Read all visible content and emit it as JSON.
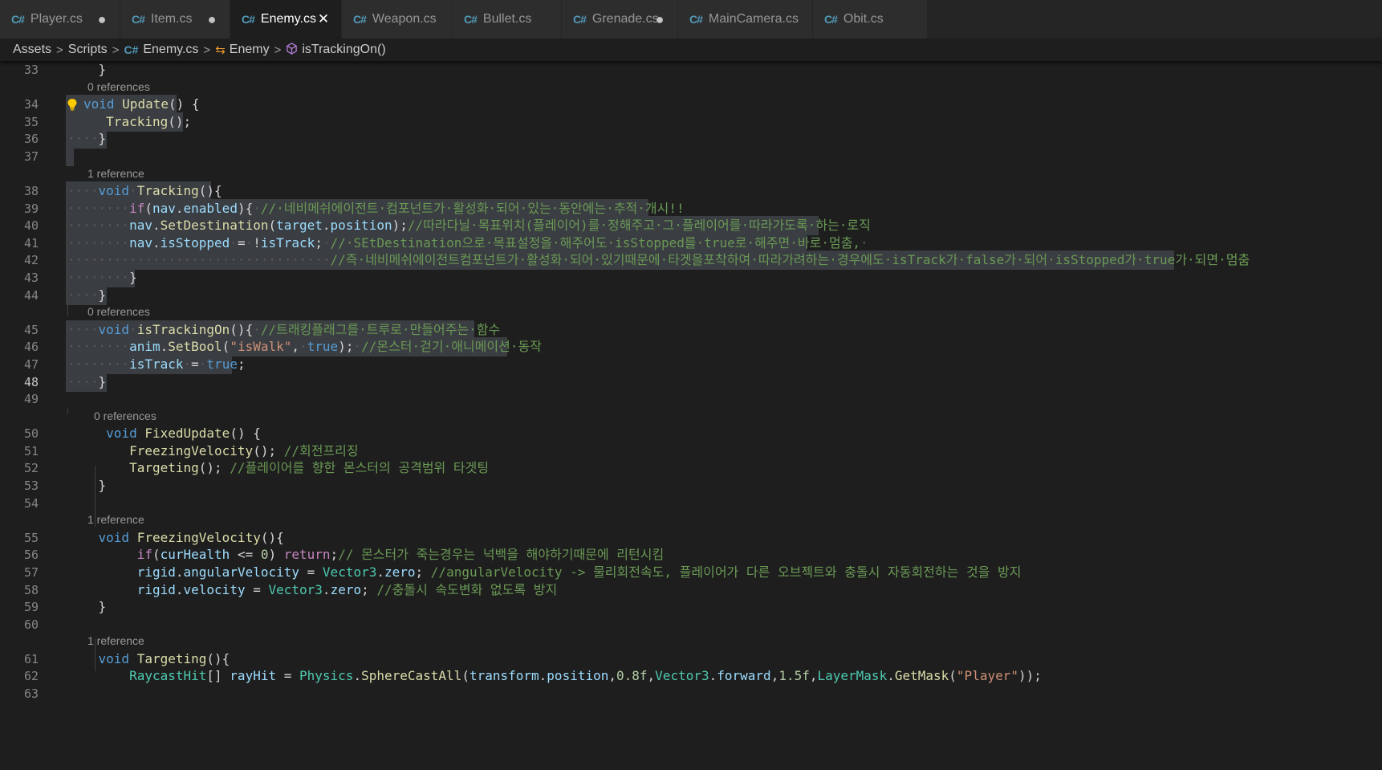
{
  "tabs": [
    {
      "label": "Player.cs",
      "status": "modified",
      "icon": "csharp-file-icon"
    },
    {
      "label": "Item.cs",
      "status": "modified",
      "icon": "csharp-file-icon"
    },
    {
      "label": "Enemy.cs",
      "status": "active-close",
      "icon": "csharp-file-icon"
    },
    {
      "label": "Weapon.cs",
      "status": "none",
      "icon": "csharp-file-icon"
    },
    {
      "label": "Bullet.cs",
      "status": "none",
      "icon": "csharp-file-icon"
    },
    {
      "label": "Grenade.cs",
      "status": "modified",
      "icon": "csharp-file-icon"
    },
    {
      "label": "MainCamera.cs",
      "status": "none",
      "icon": "csharp-file-icon"
    },
    {
      "label": "Obit.cs",
      "status": "none",
      "icon": "csharp-file-icon"
    }
  ],
  "tab_glyphs": {
    "csharp": "C#",
    "modified": "●",
    "close": "✕"
  },
  "breadcrumb": [
    {
      "label": "Assets",
      "icon": "none"
    },
    {
      "label": "Scripts",
      "icon": "none"
    },
    {
      "label": "Enemy.cs",
      "icon": "csharp-file-icon"
    },
    {
      "label": "Enemy",
      "icon": "class-icon"
    },
    {
      "label": "isTrackingOn()",
      "icon": "method-icon"
    }
  ],
  "breadcrumb_separator": ">",
  "colors": {
    "background": "#1e1e1e",
    "selection": "#3a3d41",
    "keyword": "#569cd6",
    "control": "#c586c0",
    "function": "#dcdcaa",
    "variable": "#9cdcfe",
    "type": "#4ec9b0",
    "number": "#b5cea8",
    "string": "#ce9178",
    "comment": "#6a9955",
    "lightbulb": "#ffcc00"
  },
  "editor": {
    "current_line": 48,
    "lightbulb_line": 34,
    "rows": [
      {
        "type": "code",
        "num": 33,
        "tokens": [
          [
            "p",
            "    }"
          ]
        ]
      },
      {
        "type": "lens",
        "text": "0 references"
      },
      {
        "type": "code",
        "num": 34,
        "sel": true,
        "tokens": [
          [
            "k",
            "void"
          ],
          [
            "w",
            " "
          ],
          [
            "f",
            "Update"
          ],
          [
            "p",
            "()"
          ],
          [
            "w",
            " "
          ],
          [
            "p",
            "{"
          ]
        ]
      },
      {
        "type": "code",
        "num": 35,
        "sel": true,
        "tokens": [
          [
            "w",
            "    "
          ],
          [
            "w",
            " "
          ],
          [
            "f",
            "Tracking"
          ],
          [
            "p",
            "();"
          ]
        ]
      },
      {
        "type": "code",
        "num": 36,
        "sel": true,
        "tokens": [
          [
            "w",
            "····"
          ],
          [
            "p",
            "}"
          ]
        ]
      },
      {
        "type": "code",
        "num": 37,
        "sel": true,
        "tokens": []
      },
      {
        "type": "lens",
        "text": "1 reference"
      },
      {
        "type": "code",
        "num": 38,
        "sel": true,
        "tokens": [
          [
            "w",
            "····"
          ],
          [
            "k",
            "void"
          ],
          [
            "w",
            "·"
          ],
          [
            "f",
            "Tracking"
          ],
          [
            "p",
            "(){"
          ]
        ]
      },
      {
        "type": "code",
        "num": 39,
        "sel": true,
        "tokens": [
          [
            "w",
            "········"
          ],
          [
            "c",
            "if"
          ],
          [
            "p",
            "("
          ],
          [
            "v",
            "nav"
          ],
          [
            "p",
            "."
          ],
          [
            "v",
            "enabled"
          ],
          [
            "p",
            "){"
          ],
          [
            "w",
            "·"
          ],
          [
            "m",
            "//·네비메쉬에이전트·컴포넌트가·활성화·되어·있는·동안에는·추적·개시!!"
          ]
        ]
      },
      {
        "type": "code",
        "num": 40,
        "sel": true,
        "tokens": [
          [
            "w",
            "········"
          ],
          [
            "v",
            "nav"
          ],
          [
            "p",
            "."
          ],
          [
            "f",
            "SetDestination"
          ],
          [
            "p",
            "("
          ],
          [
            "v",
            "target"
          ],
          [
            "p",
            "."
          ],
          [
            "v",
            "position"
          ],
          [
            "p",
            ");"
          ],
          [
            "m",
            "//따라다닐·목표위치(플레이어)를·정해주고·그·플레이어를·따라가도록·하는·로직"
          ]
        ]
      },
      {
        "type": "code",
        "num": 41,
        "sel": true,
        "tokens": [
          [
            "w",
            "········"
          ],
          [
            "v",
            "nav"
          ],
          [
            "p",
            "."
          ],
          [
            "v",
            "isStopped"
          ],
          [
            "w",
            "·"
          ],
          [
            "p",
            "="
          ],
          [
            "w",
            "·"
          ],
          [
            "p",
            "!"
          ],
          [
            "v",
            "isTrack"
          ],
          [
            "p",
            ";"
          ],
          [
            "w",
            "·"
          ],
          [
            "m",
            "//·SEtDestination으로·목표설정을·해주어도·isStopped를·true로·해주면·바로·멈춤,"
          ],
          [
            "w",
            "·"
          ]
        ]
      },
      {
        "type": "code",
        "num": 42,
        "sel": true,
        "tokens": [
          [
            "w",
            "··································"
          ],
          [
            "m",
            "//즉·네비메쉬에이전트컴포넌트가·활성화·되어·있기때문에·타겟을포착하여·따라가려하는·경우에도·isTrack가·false가·되어·isStopped가·true가·되면·멈춤"
          ]
        ]
      },
      {
        "type": "code",
        "num": 43,
        "sel": true,
        "tokens": [
          [
            "w",
            "········"
          ],
          [
            "p",
            "}"
          ]
        ]
      },
      {
        "type": "code",
        "num": 44,
        "sel": true,
        "tokens": [
          [
            "w",
            "····"
          ],
          [
            "p",
            "}"
          ]
        ]
      },
      {
        "type": "lens",
        "text": "0 references"
      },
      {
        "type": "code",
        "num": 45,
        "sel": true,
        "tokens": [
          [
            "w",
            "····"
          ],
          [
            "k",
            "void"
          ],
          [
            "w",
            "·"
          ],
          [
            "f",
            "isTrackingOn"
          ],
          [
            "p",
            "(){"
          ],
          [
            "w",
            "·"
          ],
          [
            "m",
            "//트래킹플래그를·트루로·만들어주는·함수"
          ]
        ]
      },
      {
        "type": "code",
        "num": 46,
        "sel": true,
        "tokens": [
          [
            "w",
            "········"
          ],
          [
            "v",
            "anim"
          ],
          [
            "p",
            "."
          ],
          [
            "f",
            "SetBool"
          ],
          [
            "p",
            "("
          ],
          [
            "s",
            "\"isWalk\""
          ],
          [
            "p",
            ","
          ],
          [
            "w",
            "·"
          ],
          [
            "k",
            "true"
          ],
          [
            "p",
            ");"
          ],
          [
            "w",
            "·"
          ],
          [
            "m",
            "//몬스터·걷기·애니메이션·동작"
          ]
        ]
      },
      {
        "type": "code",
        "num": 47,
        "sel": true,
        "tokens": [
          [
            "w",
            "········"
          ],
          [
            "v",
            "isTrack"
          ],
          [
            "w",
            "·"
          ],
          [
            "p",
            "="
          ],
          [
            "w",
            "·"
          ],
          [
            "k",
            "true"
          ],
          [
            "p",
            ";"
          ]
        ]
      },
      {
        "type": "code",
        "num": 48,
        "sel": true,
        "tokens": [
          [
            "w",
            "····"
          ],
          [
            "p",
            "}"
          ]
        ]
      },
      {
        "type": "code",
        "num": 49,
        "tokens": []
      },
      {
        "type": "lens",
        "text": "0 references",
        "indent": 1
      },
      {
        "type": "code",
        "num": 50,
        "tokens": [
          [
            "p",
            "     "
          ],
          [
            "k",
            "void"
          ],
          [
            "p",
            " "
          ],
          [
            "f",
            "FixedUpdate"
          ],
          [
            "p",
            "() {"
          ]
        ]
      },
      {
        "type": "code",
        "num": 51,
        "tokens": [
          [
            "p",
            "        "
          ],
          [
            "f",
            "FreezingVelocity"
          ],
          [
            "p",
            "(); "
          ],
          [
            "m",
            "//회전프리징"
          ]
        ]
      },
      {
        "type": "code",
        "num": 52,
        "tokens": [
          [
            "p",
            "        "
          ],
          [
            "f",
            "Targeting"
          ],
          [
            "p",
            "(); "
          ],
          [
            "m",
            "//플레이어를 향한 몬스터의 공격범위 타겟팅"
          ]
        ]
      },
      {
        "type": "code",
        "num": 53,
        "tokens": [
          [
            "p",
            "    }"
          ]
        ]
      },
      {
        "type": "code",
        "num": 54,
        "tokens": []
      },
      {
        "type": "lens",
        "text": "1 reference"
      },
      {
        "type": "code",
        "num": 55,
        "tokens": [
          [
            "p",
            "    "
          ],
          [
            "k",
            "void"
          ],
          [
            "p",
            " "
          ],
          [
            "f",
            "FreezingVelocity"
          ],
          [
            "p",
            "(){"
          ]
        ]
      },
      {
        "type": "code",
        "num": 56,
        "tokens": [
          [
            "p",
            "         "
          ],
          [
            "c",
            "if"
          ],
          [
            "p",
            "("
          ],
          [
            "v",
            "curHealth"
          ],
          [
            "p",
            " <= "
          ],
          [
            "n",
            "0"
          ],
          [
            "p",
            ") "
          ],
          [
            "c",
            "return"
          ],
          [
            "p",
            ";"
          ],
          [
            "m",
            "// 몬스터가 죽는경우는 넉백을 해야하기때문에 리턴시킴"
          ]
        ]
      },
      {
        "type": "code",
        "num": 57,
        "tokens": [
          [
            "p",
            "         "
          ],
          [
            "v",
            "rigid"
          ],
          [
            "p",
            "."
          ],
          [
            "v",
            "angularVelocity"
          ],
          [
            "p",
            " = "
          ],
          [
            "t",
            "Vector3"
          ],
          [
            "p",
            "."
          ],
          [
            "v",
            "zero"
          ],
          [
            "p",
            "; "
          ],
          [
            "m",
            "//angularVelocity -> 물리회전속도, 플레이어가 다른 오브젝트와 충돌시 자동회전하는 것을 방지"
          ]
        ]
      },
      {
        "type": "code",
        "num": 58,
        "tokens": [
          [
            "p",
            "         "
          ],
          [
            "v",
            "rigid"
          ],
          [
            "p",
            "."
          ],
          [
            "v",
            "velocity"
          ],
          [
            "p",
            " = "
          ],
          [
            "t",
            "Vector3"
          ],
          [
            "p",
            "."
          ],
          [
            "v",
            "zero"
          ],
          [
            "p",
            "; "
          ],
          [
            "m",
            "//충돌시 속도변화 없도록 방지"
          ]
        ]
      },
      {
        "type": "code",
        "num": 59,
        "tokens": [
          [
            "p",
            "    }"
          ]
        ]
      },
      {
        "type": "code",
        "num": 60,
        "tokens": []
      },
      {
        "type": "lens",
        "text": "1 reference"
      },
      {
        "type": "code",
        "num": 61,
        "tokens": [
          [
            "p",
            "    "
          ],
          [
            "k",
            "void"
          ],
          [
            "p",
            " "
          ],
          [
            "f",
            "Targeting"
          ],
          [
            "p",
            "(){"
          ]
        ]
      },
      {
        "type": "code",
        "num": 62,
        "tokens": [
          [
            "p",
            "        "
          ],
          [
            "t",
            "RaycastHit"
          ],
          [
            "p",
            "[] "
          ],
          [
            "v",
            "rayHit"
          ],
          [
            "p",
            " = "
          ],
          [
            "t",
            "Physics"
          ],
          [
            "p",
            "."
          ],
          [
            "f",
            "SphereCastAll"
          ],
          [
            "p",
            "("
          ],
          [
            "v",
            "transform"
          ],
          [
            "p",
            "."
          ],
          [
            "v",
            "position"
          ],
          [
            "p",
            ","
          ],
          [
            "n",
            "0.8f"
          ],
          [
            "p",
            ","
          ],
          [
            "t",
            "Vector3"
          ],
          [
            "p",
            "."
          ],
          [
            "v",
            "forward"
          ],
          [
            "p",
            ","
          ],
          [
            "n",
            "1.5f"
          ],
          [
            "p",
            ","
          ],
          [
            "t",
            "LayerMask"
          ],
          [
            "p",
            "."
          ],
          [
            "f",
            "GetMask"
          ],
          [
            "p",
            "("
          ],
          [
            "s",
            "\"Player\""
          ],
          [
            "p",
            "));"
          ]
        ]
      },
      {
        "type": "code",
        "num": 63,
        "tokens": []
      }
    ]
  }
}
